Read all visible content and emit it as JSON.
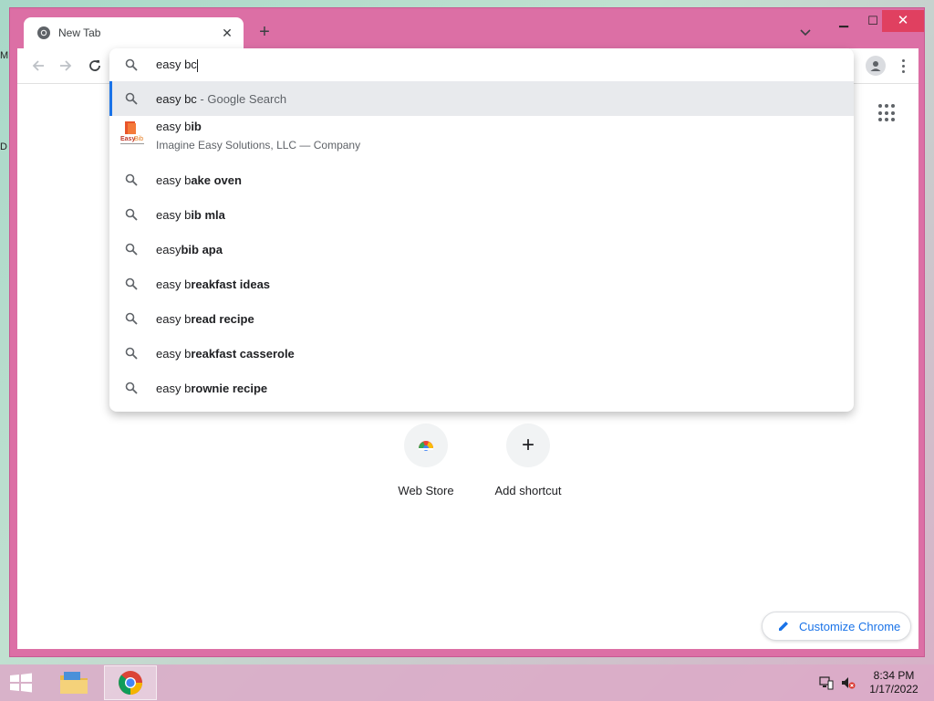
{
  "desktop": {
    "edge_labels": [
      "M",
      "D"
    ]
  },
  "window": {
    "tab": {
      "title": "New Tab"
    },
    "controls": {
      "minimize": "▁",
      "maximize": "☐",
      "close": "✕"
    },
    "new_tab": "+"
  },
  "omnibox": {
    "query_typed": "easy bc",
    "suggestions": [
      {
        "kind": "search",
        "prefix": "easy bc",
        "suffix": " - Google Search",
        "selected": true
      },
      {
        "kind": "entity",
        "prefix": "easy b",
        "bold": "ib",
        "subtitle": "Imagine Easy Solutions, LLC — Company"
      },
      {
        "kind": "search",
        "prefix": "easy b",
        "bold": "ake oven"
      },
      {
        "kind": "search",
        "prefix": "easy b",
        "bold": "ib mla"
      },
      {
        "kind": "search",
        "prefix": "easy",
        "bold": "bib apa"
      },
      {
        "kind": "search",
        "prefix": "easy b",
        "bold": "reakfast ideas"
      },
      {
        "kind": "search",
        "prefix": "easy b",
        "bold": "read recipe"
      },
      {
        "kind": "search",
        "prefix": "easy b",
        "bold": "reakfast casserole"
      },
      {
        "kind": "search",
        "prefix": "easy b",
        "bold": "rownie recipe"
      }
    ]
  },
  "ntp": {
    "shortcuts": [
      {
        "label": "Web Store"
      },
      {
        "label": "Add shortcut",
        "icon": "+"
      }
    ],
    "customize_label": "Customize Chrome"
  },
  "taskbar": {
    "clock_time": "8:34 PM",
    "clock_date": "1/17/2022"
  },
  "colors": {
    "window_frame": "#dc6fa5",
    "accent": "#1a73e8",
    "selected_row": "#e8eaed",
    "close_button": "#e04060"
  }
}
